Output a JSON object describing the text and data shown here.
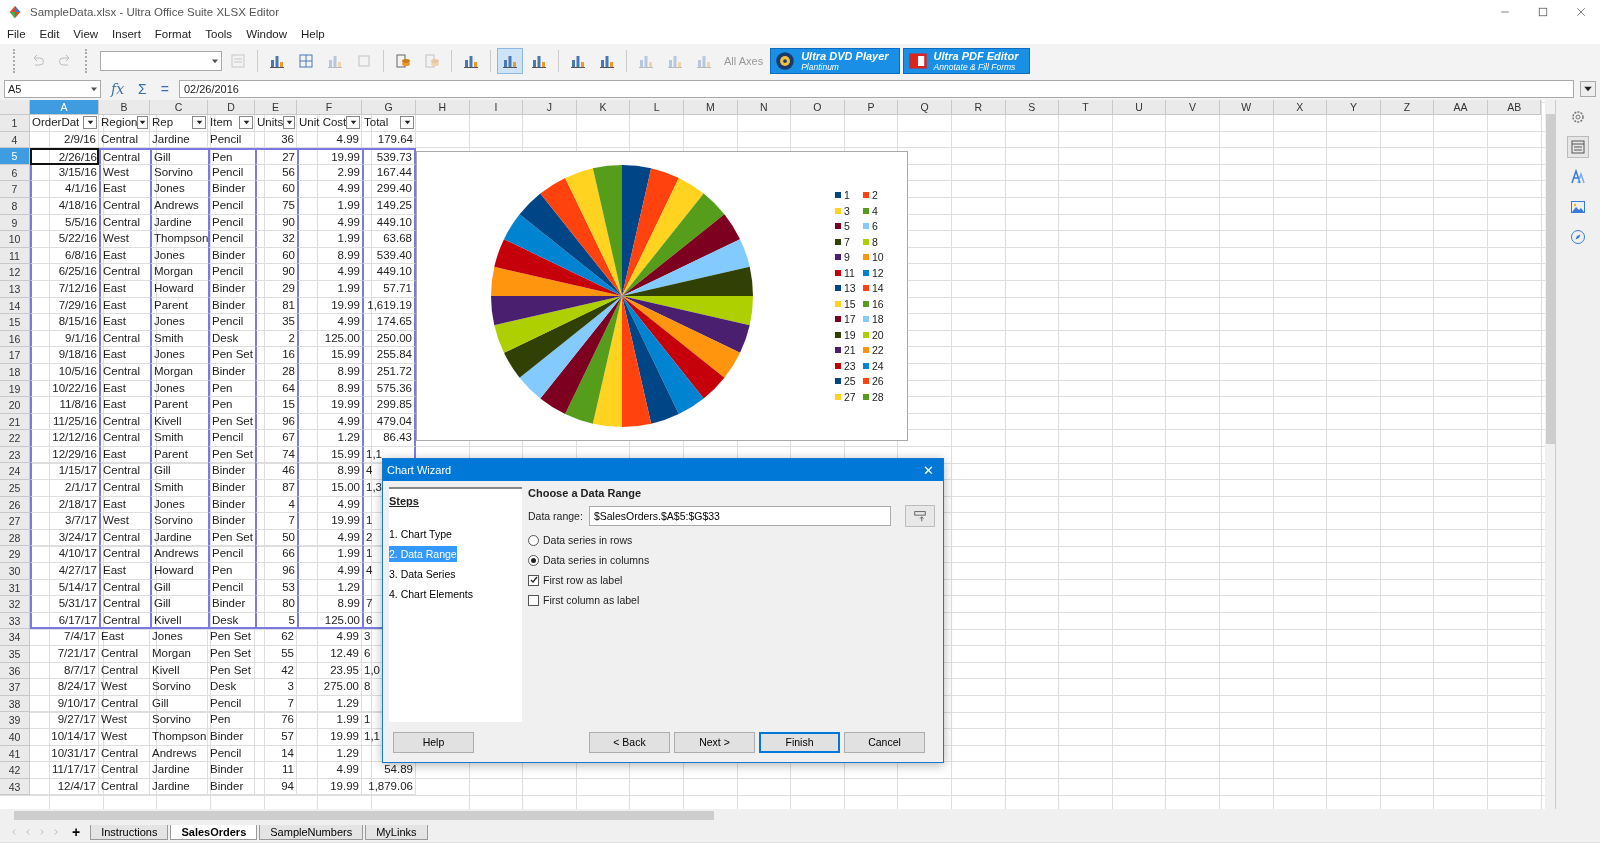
{
  "window": {
    "title": "SampleData.xlsx - Ultra Office Suite XLSX Editor"
  },
  "menu": [
    "File",
    "Edit",
    "View",
    "Insert",
    "Format",
    "Tools",
    "Window",
    "Help"
  ],
  "toolbar": {
    "undo_disabled": true,
    "redo_disabled": true,
    "tools": [
      {
        "selected": false,
        "disabled": true
      },
      {
        "selected": false,
        "disabled": false
      },
      {
        "selected": false,
        "disabled": false
      },
      {
        "selected": false,
        "disabled": true
      },
      {
        "selected": false,
        "disabled": true
      },
      {
        "selected": false,
        "disabled": false
      },
      {
        "selected": false,
        "disabled": true
      },
      {
        "selected": false,
        "disabled": false
      },
      {
        "selected": true,
        "disabled": false
      },
      {
        "selected": false,
        "disabled": false
      },
      {
        "selected": false,
        "disabled": false
      },
      {
        "selected": false,
        "disabled": false
      },
      {
        "selected": false,
        "disabled": true
      },
      {
        "selected": false,
        "disabled": true
      },
      {
        "selected": false,
        "disabled": true
      }
    ],
    "all_axes": {
      "label": "All Axes",
      "disabled": true
    },
    "ads": [
      {
        "title": "Ultra DVD Player",
        "subtitle": "Plantinum"
      },
      {
        "title": "Ultra PDF Editor",
        "subtitle": "Annotate & Fill Forms"
      }
    ]
  },
  "formula_bar": {
    "cell": "A5",
    "fx": "fx",
    "sum": "Σ",
    "equals": "=",
    "value": "02/26/2016"
  },
  "columns": [
    {
      "label": "A",
      "selected": true
    },
    {
      "label": "B",
      "selected": false
    },
    {
      "label": "C",
      "selected": false
    },
    {
      "label": "D",
      "selected": false
    },
    {
      "label": "E",
      "selected": false
    },
    {
      "label": "F",
      "selected": false
    },
    {
      "label": "G",
      "selected": false
    },
    {
      "label": "H",
      "selected": false
    },
    {
      "label": "I",
      "selected": false
    },
    {
      "label": "J",
      "selected": false
    },
    {
      "label": "K",
      "selected": false
    },
    {
      "label": "L",
      "selected": false
    },
    {
      "label": "M",
      "selected": false
    },
    {
      "label": "N",
      "selected": false
    },
    {
      "label": "O",
      "selected": false
    },
    {
      "label": "P",
      "selected": false
    },
    {
      "label": "Q",
      "selected": false
    },
    {
      "label": "R",
      "selected": false
    },
    {
      "label": "S",
      "selected": false
    },
    {
      "label": "T",
      "selected": false
    },
    {
      "label": "U",
      "selected": false
    },
    {
      "label": "V",
      "selected": false
    },
    {
      "label": "W",
      "selected": false
    },
    {
      "label": "X",
      "selected": false
    },
    {
      "label": "Y",
      "selected": false
    },
    {
      "label": "Z",
      "selected": false
    },
    {
      "label": "AA",
      "selected": false
    },
    {
      "label": "AB",
      "selected": false
    }
  ],
  "header_row": {
    "num": "1",
    "headers": [
      "OrderDat",
      "Region",
      "Rep",
      "Item",
      "Units",
      "Unit Cost",
      "Total"
    ]
  },
  "rows": [
    {
      "num": "4",
      "cells": [
        "2/9/16",
        "Central",
        "Jardine",
        "Pencil",
        "36",
        "4.99",
        "179.64"
      ],
      "range": false,
      "active": false,
      "total_cut": false
    },
    {
      "num": "5",
      "cells": [
        "2/26/16",
        "Central",
        "Gill",
        "Pen",
        "27",
        "19.99",
        "539.73"
      ],
      "range": true,
      "active": true,
      "total_cut": false
    },
    {
      "num": "6",
      "cells": [
        "3/15/16",
        "West",
        "Sorvino",
        "Pencil",
        "56",
        "2.99",
        "167.44"
      ],
      "range": true,
      "active": false,
      "total_cut": false
    },
    {
      "num": "7",
      "cells": [
        "4/1/16",
        "East",
        "Jones",
        "Binder",
        "60",
        "4.99",
        "299.40"
      ],
      "range": true,
      "active": false,
      "total_cut": false
    },
    {
      "num": "8",
      "cells": [
        "4/18/16",
        "Central",
        "Andrews",
        "Pencil",
        "75",
        "1.99",
        "149.25"
      ],
      "range": true,
      "active": false,
      "total_cut": false
    },
    {
      "num": "9",
      "cells": [
        "5/5/16",
        "Central",
        "Jardine",
        "Pencil",
        "90",
        "4.99",
        "449.10"
      ],
      "range": true,
      "active": false,
      "total_cut": false
    },
    {
      "num": "10",
      "cells": [
        "5/22/16",
        "West",
        "Thompson",
        "Pencil",
        "32",
        "1.99",
        "63.68"
      ],
      "range": true,
      "active": false,
      "total_cut": false
    },
    {
      "num": "11",
      "cells": [
        "6/8/16",
        "East",
        "Jones",
        "Binder",
        "60",
        "8.99",
        "539.40"
      ],
      "range": true,
      "active": false,
      "total_cut": false
    },
    {
      "num": "12",
      "cells": [
        "6/25/16",
        "Central",
        "Morgan",
        "Pencil",
        "90",
        "4.99",
        "449.10"
      ],
      "range": true,
      "active": false,
      "total_cut": false
    },
    {
      "num": "13",
      "cells": [
        "7/12/16",
        "East",
        "Howard",
        "Binder",
        "29",
        "1.99",
        "57.71"
      ],
      "range": true,
      "active": false,
      "total_cut": false
    },
    {
      "num": "14",
      "cells": [
        "7/29/16",
        "East",
        "Parent",
        "Binder",
        "81",
        "19.99",
        "1,619.19"
      ],
      "range": true,
      "active": false,
      "total_cut": false
    },
    {
      "num": "15",
      "cells": [
        "8/15/16",
        "East",
        "Jones",
        "Pencil",
        "35",
        "4.99",
        "174.65"
      ],
      "range": true,
      "active": false,
      "total_cut": false
    },
    {
      "num": "16",
      "cells": [
        "9/1/16",
        "Central",
        "Smith",
        "Desk",
        "2",
        "125.00",
        "250.00"
      ],
      "range": true,
      "active": false,
      "total_cut": false
    },
    {
      "num": "17",
      "cells": [
        "9/18/16",
        "East",
        "Jones",
        "Pen Set",
        "16",
        "15.99",
        "255.84"
      ],
      "range": true,
      "active": false,
      "total_cut": false
    },
    {
      "num": "18",
      "cells": [
        "10/5/16",
        "Central",
        "Morgan",
        "Binder",
        "28",
        "8.99",
        "251.72"
      ],
      "range": true,
      "active": false,
      "total_cut": false
    },
    {
      "num": "19",
      "cells": [
        "10/22/16",
        "East",
        "Jones",
        "Pen",
        "64",
        "8.99",
        "575.36"
      ],
      "range": true,
      "active": false,
      "total_cut": false
    },
    {
      "num": "20",
      "cells": [
        "11/8/16",
        "East",
        "Parent",
        "Pen",
        "15",
        "19.99",
        "299.85"
      ],
      "range": true,
      "active": false,
      "total_cut": false
    },
    {
      "num": "21",
      "cells": [
        "11/25/16",
        "Central",
        "Kivell",
        "Pen Set",
        "96",
        "4.99",
        "479.04"
      ],
      "range": true,
      "active": false,
      "total_cut": false
    },
    {
      "num": "22",
      "cells": [
        "12/12/16",
        "Central",
        "Smith",
        "Pencil",
        "67",
        "1.29",
        "86.43"
      ],
      "range": true,
      "active": false,
      "total_cut": false
    },
    {
      "num": "23",
      "cells": [
        "12/29/16",
        "East",
        "Parent",
        "Pen Set",
        "74",
        "15.99",
        "1,1"
      ],
      "range": true,
      "active": false,
      "total_cut": true
    },
    {
      "num": "24",
      "cells": [
        "1/15/17",
        "Central",
        "Gill",
        "Binder",
        "46",
        "8.99",
        "4"
      ],
      "range": true,
      "active": false,
      "total_cut": true
    },
    {
      "num": "25",
      "cells": [
        "2/1/17",
        "Central",
        "Smith",
        "Binder",
        "87",
        "15.00",
        "1,3"
      ],
      "range": true,
      "active": false,
      "total_cut": true
    },
    {
      "num": "26",
      "cells": [
        "2/18/17",
        "East",
        "Jones",
        "Binder",
        "4",
        "4.99"
      ],
      "range": true,
      "active": false
    },
    {
      "num": "27",
      "cells": [
        "3/7/17",
        "West",
        "Sorvino",
        "Binder",
        "7",
        "19.99",
        "1"
      ],
      "range": true,
      "active": false,
      "total_cut": true
    },
    {
      "num": "28",
      "cells": [
        "3/24/17",
        "Central",
        "Jardine",
        "Pen Set",
        "50",
        "4.99",
        "2"
      ],
      "range": true,
      "active": false,
      "total_cut": true
    },
    {
      "num": "29",
      "cells": [
        "4/10/17",
        "Central",
        "Andrews",
        "Pencil",
        "66",
        "1.99",
        "1"
      ],
      "range": true,
      "active": false,
      "total_cut": true
    },
    {
      "num": "30",
      "cells": [
        "4/27/17",
        "East",
        "Howard",
        "Pen",
        "96",
        "4.99",
        "4"
      ],
      "range": true,
      "active": false,
      "total_cut": true
    },
    {
      "num": "31",
      "cells": [
        "5/14/17",
        "Central",
        "Gill",
        "Pencil",
        "53",
        "1.29"
      ],
      "range": true,
      "active": false
    },
    {
      "num": "32",
      "cells": [
        "5/31/17",
        "Central",
        "Gill",
        "Binder",
        "80",
        "8.99",
        "7"
      ],
      "range": true,
      "active": false,
      "total_cut": true
    },
    {
      "num": "33",
      "cells": [
        "6/17/17",
        "Central",
        "Kivell",
        "Desk",
        "5",
        "125.00",
        "6"
      ],
      "range": true,
      "active": false,
      "total_cut": true
    },
    {
      "num": "34",
      "cells": [
        "7/4/17",
        "East",
        "Jones",
        "Pen Set",
        "62",
        "4.99",
        "3"
      ],
      "range": false,
      "active": false,
      "total_cut": true
    },
    {
      "num": "35",
      "cells": [
        "7/21/17",
        "Central",
        "Morgan",
        "Pen Set",
        "55",
        "12.49",
        "6"
      ],
      "range": false,
      "active": false,
      "total_cut": true
    },
    {
      "num": "36",
      "cells": [
        "8/7/17",
        "Central",
        "Kivell",
        "Pen Set",
        "42",
        "23.95",
        "1,0"
      ],
      "range": false,
      "active": false,
      "total_cut": true
    },
    {
      "num": "37",
      "cells": [
        "8/24/17",
        "West",
        "Sorvino",
        "Desk",
        "3",
        "275.00",
        "8"
      ],
      "range": false,
      "active": false,
      "total_cut": true
    },
    {
      "num": "38",
      "cells": [
        "9/10/17",
        "Central",
        "Gill",
        "Pencil",
        "7",
        "1.29"
      ],
      "range": false,
      "active": false
    },
    {
      "num": "39",
      "cells": [
        "9/27/17",
        "West",
        "Sorvino",
        "Pen",
        "76",
        "1.99",
        "1"
      ],
      "range": false,
      "active": false,
      "total_cut": true
    },
    {
      "num": "40",
      "cells": [
        "10/14/17",
        "West",
        "Thompson",
        "Binder",
        "57",
        "19.99",
        "1,1"
      ],
      "range": false,
      "active": false,
      "total_cut": true
    },
    {
      "num": "41",
      "cells": [
        "10/31/17",
        "Central",
        "Andrews",
        "Pencil",
        "14",
        "1.29"
      ],
      "range": false,
      "active": false
    },
    {
      "num": "42",
      "cells": [
        "11/17/17",
        "Central",
        "Jardine",
        "Binder",
        "11",
        "4.99",
        "54.89"
      ],
      "range": false,
      "active": false,
      "total_cut": false
    },
    {
      "num": "43",
      "cells": [
        "12/4/17",
        "Central",
        "Jardine",
        "Binder",
        "94",
        "19.99",
        "1,879.06"
      ],
      "range": false,
      "active": false,
      "total_cut": false
    }
  ],
  "chart": {
    "legend": [
      {
        "label": "1",
        "color": "#004586"
      },
      {
        "label": "2",
        "color": "#ff420e"
      },
      {
        "label": "3",
        "color": "#ffd320"
      },
      {
        "label": "4",
        "color": "#579d1c"
      },
      {
        "label": "5",
        "color": "#7e0021"
      },
      {
        "label": "6",
        "color": "#83caff"
      },
      {
        "label": "7",
        "color": "#314004"
      },
      {
        "label": "8",
        "color": "#aecf00"
      },
      {
        "label": "9",
        "color": "#4b1f6f"
      },
      {
        "label": "10",
        "color": "#ff950e"
      },
      {
        "label": "11",
        "color": "#c5000b"
      },
      {
        "label": "12",
        "color": "#0084d1"
      },
      {
        "label": "13",
        "color": "#004586"
      },
      {
        "label": "14",
        "color": "#ff420e"
      },
      {
        "label": "15",
        "color": "#ffd320"
      },
      {
        "label": "16",
        "color": "#579d1c"
      },
      {
        "label": "17",
        "color": "#7e0021"
      },
      {
        "label": "18",
        "color": "#83caff"
      },
      {
        "label": "19",
        "color": "#314004"
      },
      {
        "label": "20",
        "color": "#aecf00"
      },
      {
        "label": "21",
        "color": "#4b1f6f"
      },
      {
        "label": "22",
        "color": "#ff950e"
      },
      {
        "label": "23",
        "color": "#c5000b"
      },
      {
        "label": "24",
        "color": "#0084d1"
      },
      {
        "label": "25",
        "color": "#004586"
      },
      {
        "label": "26",
        "color": "#ff420e"
      },
      {
        "label": "27",
        "color": "#ffd320"
      },
      {
        "label": "28",
        "color": "#579d1c"
      }
    ]
  },
  "dialog": {
    "title": "Chart Wizard",
    "close": "✕",
    "steps_title": "Steps",
    "steps": [
      {
        "label": "1. Chart Type",
        "selected": false
      },
      {
        "label": "2. Data Range",
        "selected": true
      },
      {
        "label": "3. Data Series",
        "selected": false
      },
      {
        "label": "4. Chart Elements",
        "selected": false
      }
    ],
    "heading": "Choose a Data Range",
    "range_label": "Data range:",
    "range_value": "$SalesOrders.$A$5:$G$33",
    "options": [
      {
        "kind": "radio",
        "label": "Data series in rows",
        "checked": false
      },
      {
        "kind": "radio",
        "label": "Data series in columns",
        "checked": true
      },
      {
        "kind": "checkbox",
        "label": "First row as label",
        "checked": true
      },
      {
        "kind": "checkbox",
        "label": "First column as label",
        "checked": false
      }
    ],
    "buttons": [
      {
        "label": "Help",
        "default": false
      },
      {
        "label": "< Back",
        "default": false
      },
      {
        "label": "Next >",
        "default": false
      },
      {
        "label": "Finish",
        "default": true
      },
      {
        "label": "Cancel",
        "default": false
      }
    ]
  },
  "sheet_tabs": {
    "add": "+",
    "tabs": [
      {
        "label": "Instructions",
        "selected": false
      },
      {
        "label": "SalesOrders",
        "selected": true
      },
      {
        "label": "SampleNumbers",
        "selected": false
      },
      {
        "label": "MyLinks",
        "selected": false
      }
    ]
  }
}
